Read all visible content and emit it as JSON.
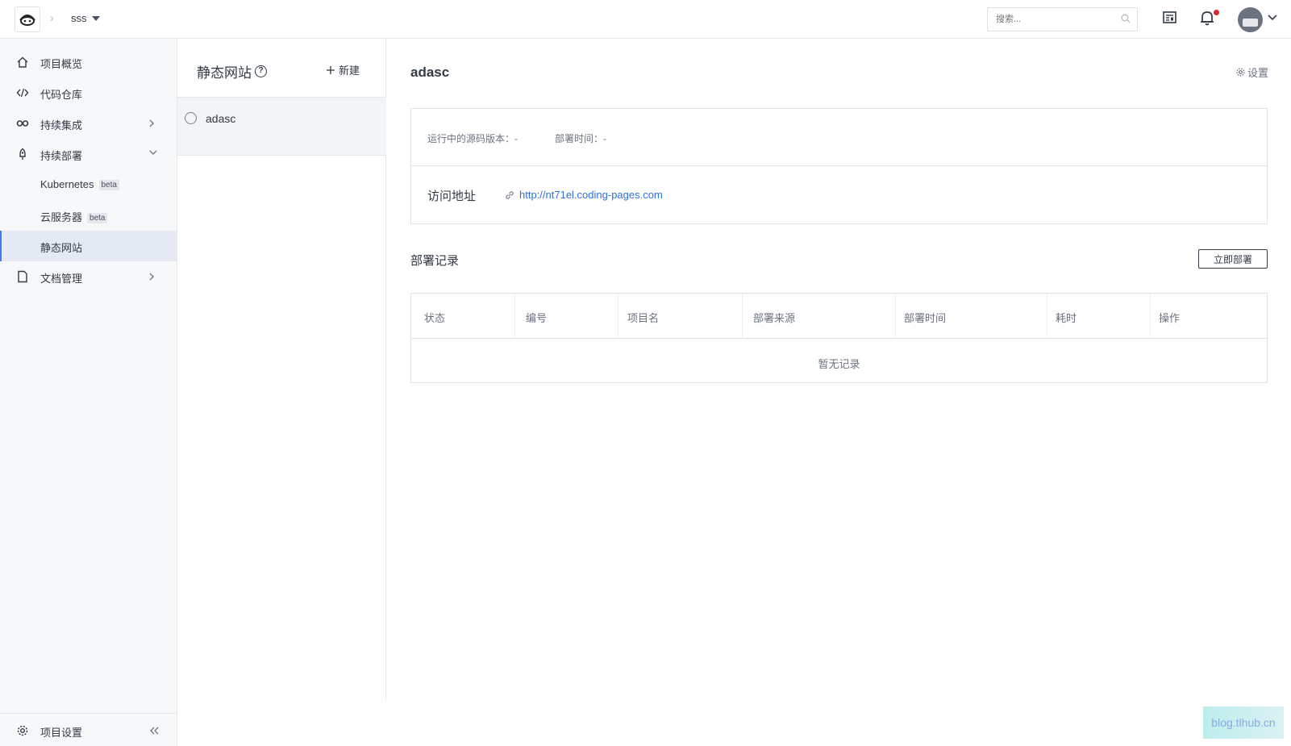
{
  "header": {
    "project_name": "sss",
    "search_placeholder": "搜索..."
  },
  "sidebar": {
    "items": [
      {
        "label": "项目概览",
        "icon": "home-icon"
      },
      {
        "label": "代码仓库",
        "icon": "code-icon"
      },
      {
        "label": "持续集成",
        "icon": "infinity-icon"
      },
      {
        "label": "持续部署",
        "icon": "rocket-icon"
      },
      {
        "label": "Kubernetes",
        "badge": "beta"
      },
      {
        "label": "云服务器",
        "badge": "beta"
      },
      {
        "label": "静态网站"
      },
      {
        "label": "文档管理",
        "icon": "document-icon"
      }
    ],
    "settings_label": "项目设置"
  },
  "sites": {
    "title": "静态网站",
    "new_label": "新建",
    "items": [
      {
        "name": "adasc"
      }
    ]
  },
  "detail": {
    "title": "adasc",
    "settings_label": "设置",
    "running_version": "运行中的源码版本：-",
    "deploy_time": "部署时间：-",
    "access_label": "访问地址",
    "access_url": "http://nt71el.coding-pages.com"
  },
  "records": {
    "title": "部署记录",
    "deploy_now_label": "立即部署",
    "columns": [
      "状态",
      "编号",
      "项目名",
      "部署来源",
      "部署时间",
      "耗时",
      "操作"
    ],
    "empty_text": "暂无记录"
  },
  "watermark": "blog.tlhub.cn"
}
